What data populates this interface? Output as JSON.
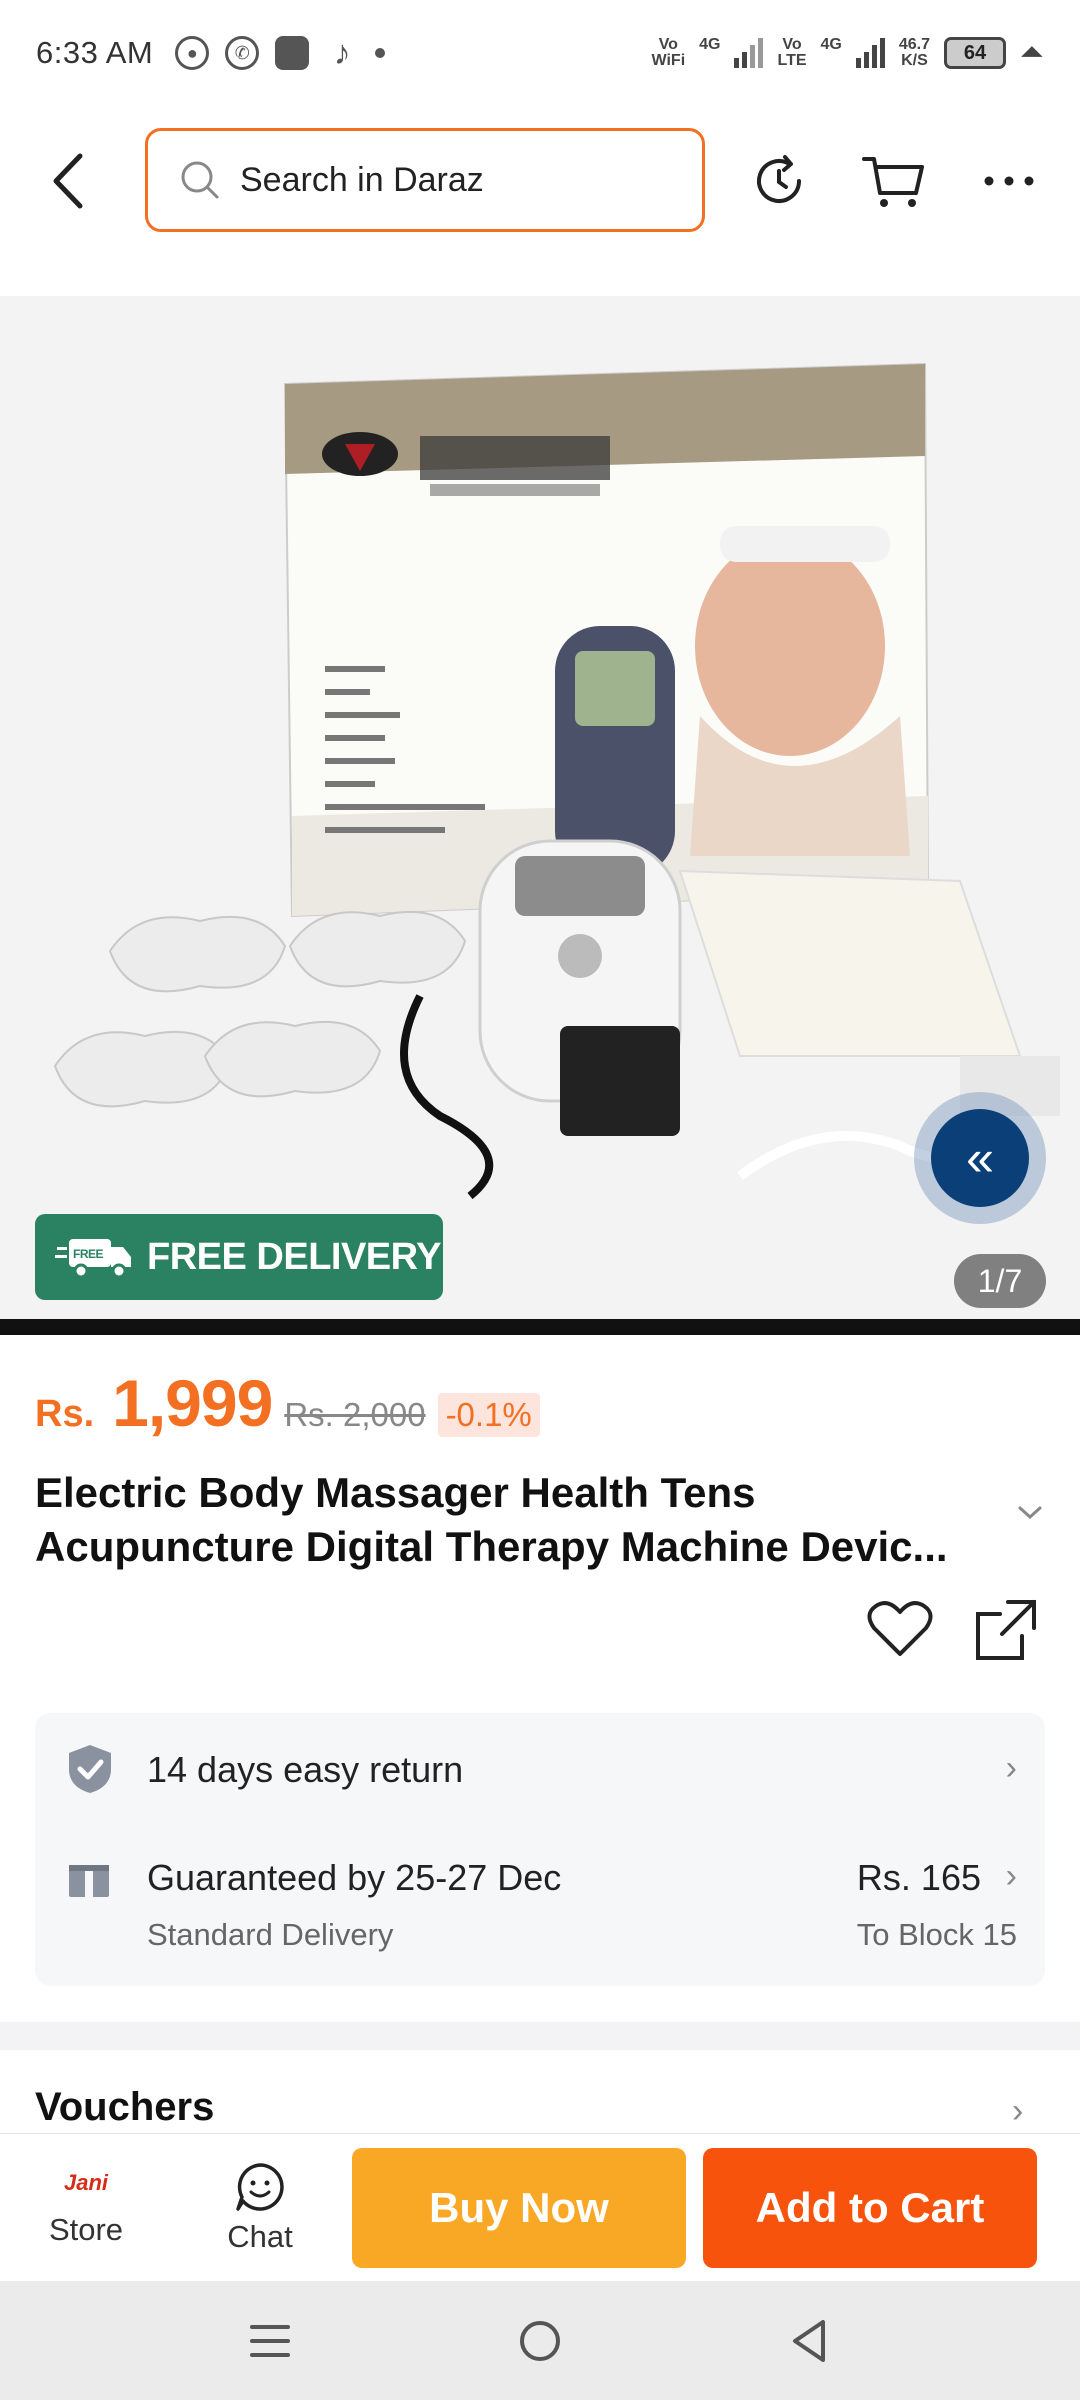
{
  "status_bar": {
    "time": "6:33 AM",
    "net1_top": "Vo",
    "net1_bottom": "WiFi",
    "net1_gen": "4G",
    "net2_top": "Vo",
    "net2_bottom": "LTE",
    "net2_gen": "4G",
    "speed_value": "46.7",
    "speed_unit": "K/S",
    "battery": "64"
  },
  "header": {
    "search_placeholder": "Search in Daraz"
  },
  "gallery": {
    "badge": "FREE DELIVERY",
    "badge_truck_text": "FREE",
    "counter": "1/7",
    "current_index": 1,
    "total": 7
  },
  "product": {
    "currency": "Rs.",
    "price": "1,999",
    "original_price": "Rs. 2,000",
    "discount": "-0.1%",
    "title_line1": "Electric Body Massager Health Tens",
    "title_line2": "Acupuncture Digital Therapy Machine Devic..."
  },
  "services": {
    "return": "14 days easy return",
    "delivery_title": "Guaranteed by 25-27 Dec",
    "delivery_type": "Standard Delivery",
    "delivery_fee": "Rs. 165",
    "delivery_destination": "To Block 15"
  },
  "vouchers": {
    "title": "Vouchers"
  },
  "actions": {
    "store_label": "Store",
    "store_logo_text": "Jani",
    "chat_label": "Chat",
    "buy_now": "Buy Now",
    "add_to_cart": "Add to Cart"
  },
  "colors": {
    "accent": "#f36f21",
    "buy_now": "#f9a825",
    "add_to_cart": "#f8530d",
    "free_delivery": "#2a8263"
  }
}
